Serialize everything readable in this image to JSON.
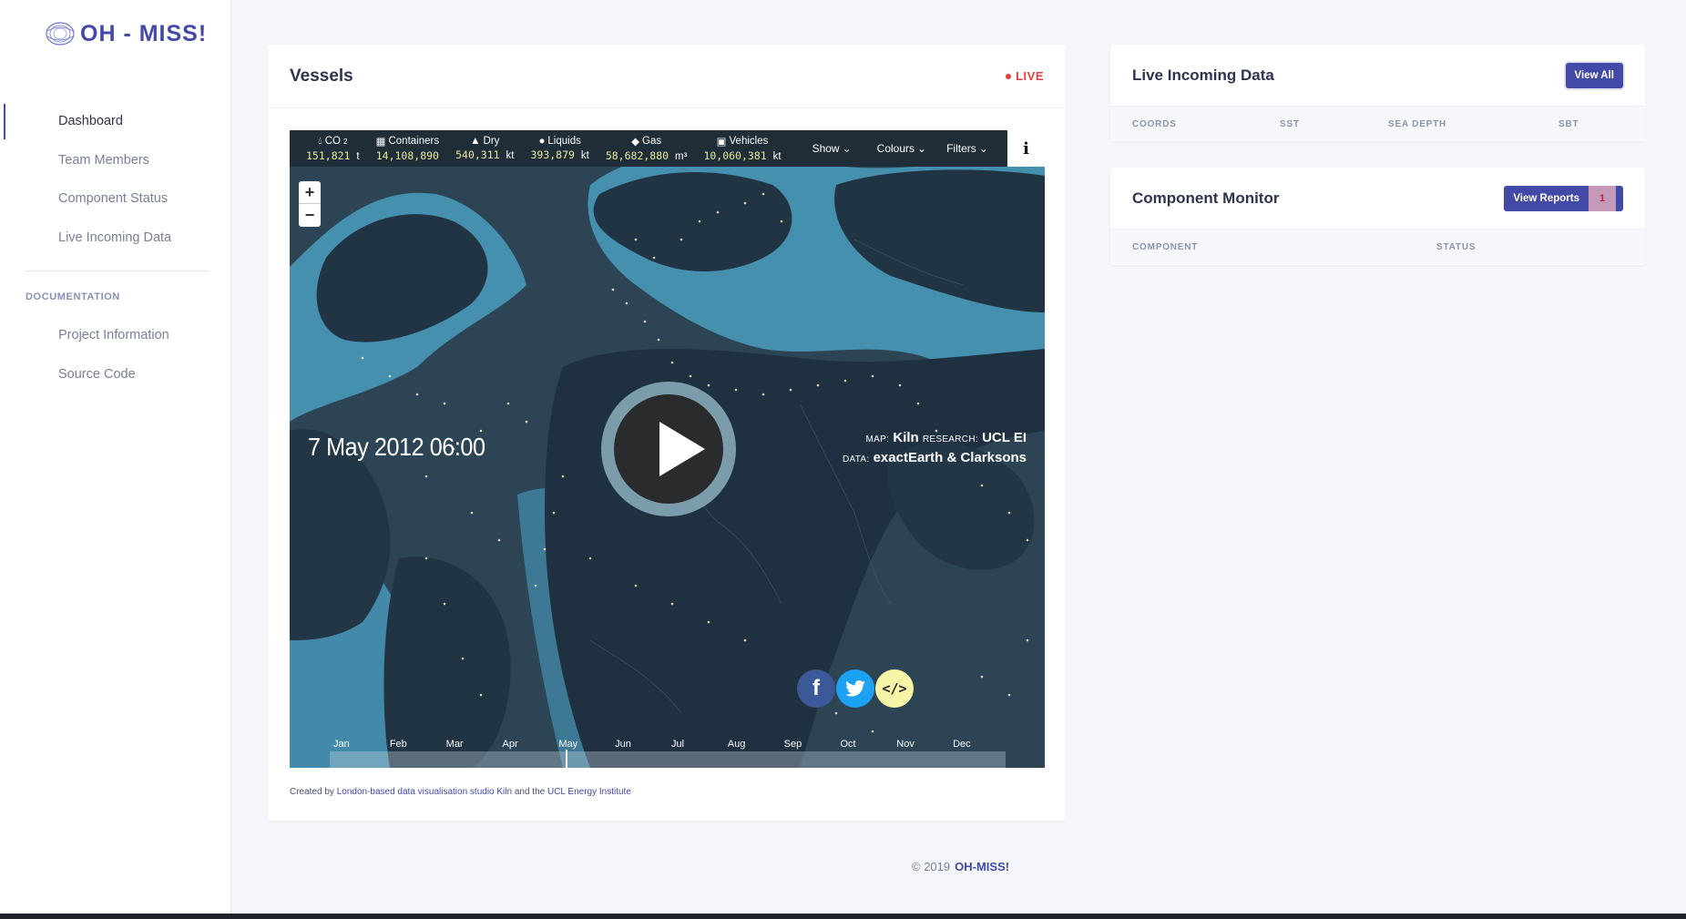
{
  "app": {
    "name": "OH - MISS!"
  },
  "sidebar": {
    "items": [
      {
        "label": "Dashboard",
        "active": true
      },
      {
        "label": "Team Members"
      },
      {
        "label": "Component Status"
      },
      {
        "label": "Live Incoming Data"
      }
    ],
    "section_title": "DOCUMENTATION",
    "doc_items": [
      {
        "label": "Project Information"
      },
      {
        "label": "Source Code"
      }
    ]
  },
  "vessels": {
    "title": "Vessels",
    "live_label": "LIVE",
    "toolbar": {
      "stats": [
        {
          "label": "CO",
          "sub": "2",
          "value": "151,821",
          "unit": "t",
          "icon": "fuel-drop-icon"
        },
        {
          "label": "Containers",
          "value": "14,108,890",
          "unit": "",
          "icon": "grid-icon"
        },
        {
          "label": "Dry",
          "value": "540,311",
          "unit": "kt",
          "icon": "triangle-up-icon"
        },
        {
          "label": "Liquids",
          "value": "393,879",
          "unit": "kt",
          "icon": "drop-icon"
        },
        {
          "label": "Gas",
          "value": "58,682,880",
          "unit": "m³",
          "icon": "flame-icon"
        },
        {
          "label": "Vehicles",
          "value": "10,060,381",
          "unit": "kt",
          "icon": "car-icon"
        }
      ],
      "dropdowns": [
        "Show",
        "Colours",
        "Filters"
      ],
      "info": "i"
    },
    "zoom_in": "+",
    "zoom_out": "−",
    "date": "7 May 2012 06:00",
    "credit_map_label": "MAP:",
    "credit_map": "Kiln",
    "credit_research_label": "RESEARCH:",
    "credit_research": "UCL EI",
    "credit_data_label": "DATA:",
    "credit_data": "exactEarth & Clarksons",
    "share": {
      "facebook": "f",
      "code": "</>"
    },
    "months": [
      "Jan",
      "Feb",
      "Mar",
      "Apr",
      "May",
      "Jun",
      "Jul",
      "Aug",
      "Sep",
      "Oct",
      "Nov",
      "Dec"
    ],
    "footer_prefix": "Created by ",
    "footer_link1": "London-based data visualisation studio Kiln",
    "footer_mid": " and the ",
    "footer_link2": "UCL Energy Institute"
  },
  "incoming": {
    "title": "Live Incoming Data",
    "button": "View All",
    "columns": [
      "COORDS",
      "SST",
      "SEA DEPTH",
      "SBT"
    ]
  },
  "monitor": {
    "title": "Component Monitor",
    "button": "View Reports",
    "badge": "1",
    "columns": [
      "COMPONENT",
      "STATUS"
    ]
  },
  "footer": {
    "year": "© 2019",
    "brand": "OH-MISS!"
  },
  "colors": {
    "accent": "#4249a7",
    "live": "#e33e3e",
    "ocean": "#2a3d4b",
    "shelf": "#5ab4d6"
  }
}
